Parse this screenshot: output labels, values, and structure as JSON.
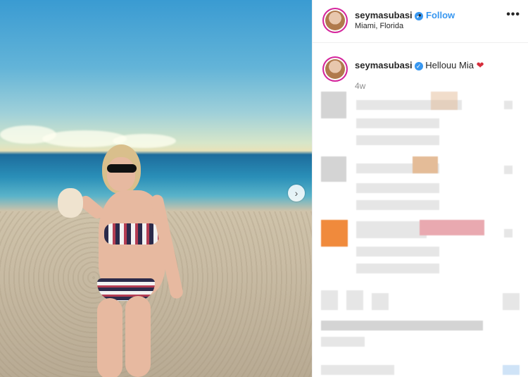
{
  "post": {
    "username": "seymasubasi",
    "follow_label": "Follow",
    "separator": "•",
    "location": "Miami, Florida",
    "more_label": "•••",
    "caption_user": "seymasubasi",
    "caption_text": "Hellouu Mia",
    "caption_emoji": "❤",
    "time_ago": "4w",
    "verified_glyph": "✓",
    "next_glyph": "›"
  },
  "colors": {
    "accent": "#3897f0",
    "heart": "#d62d3b",
    "text": "#262626",
    "muted": "#8e8e8e"
  },
  "icons": [
    "verified-badge-icon",
    "more-options-icon",
    "next-arrow-icon",
    "heart-emoji-icon"
  ]
}
